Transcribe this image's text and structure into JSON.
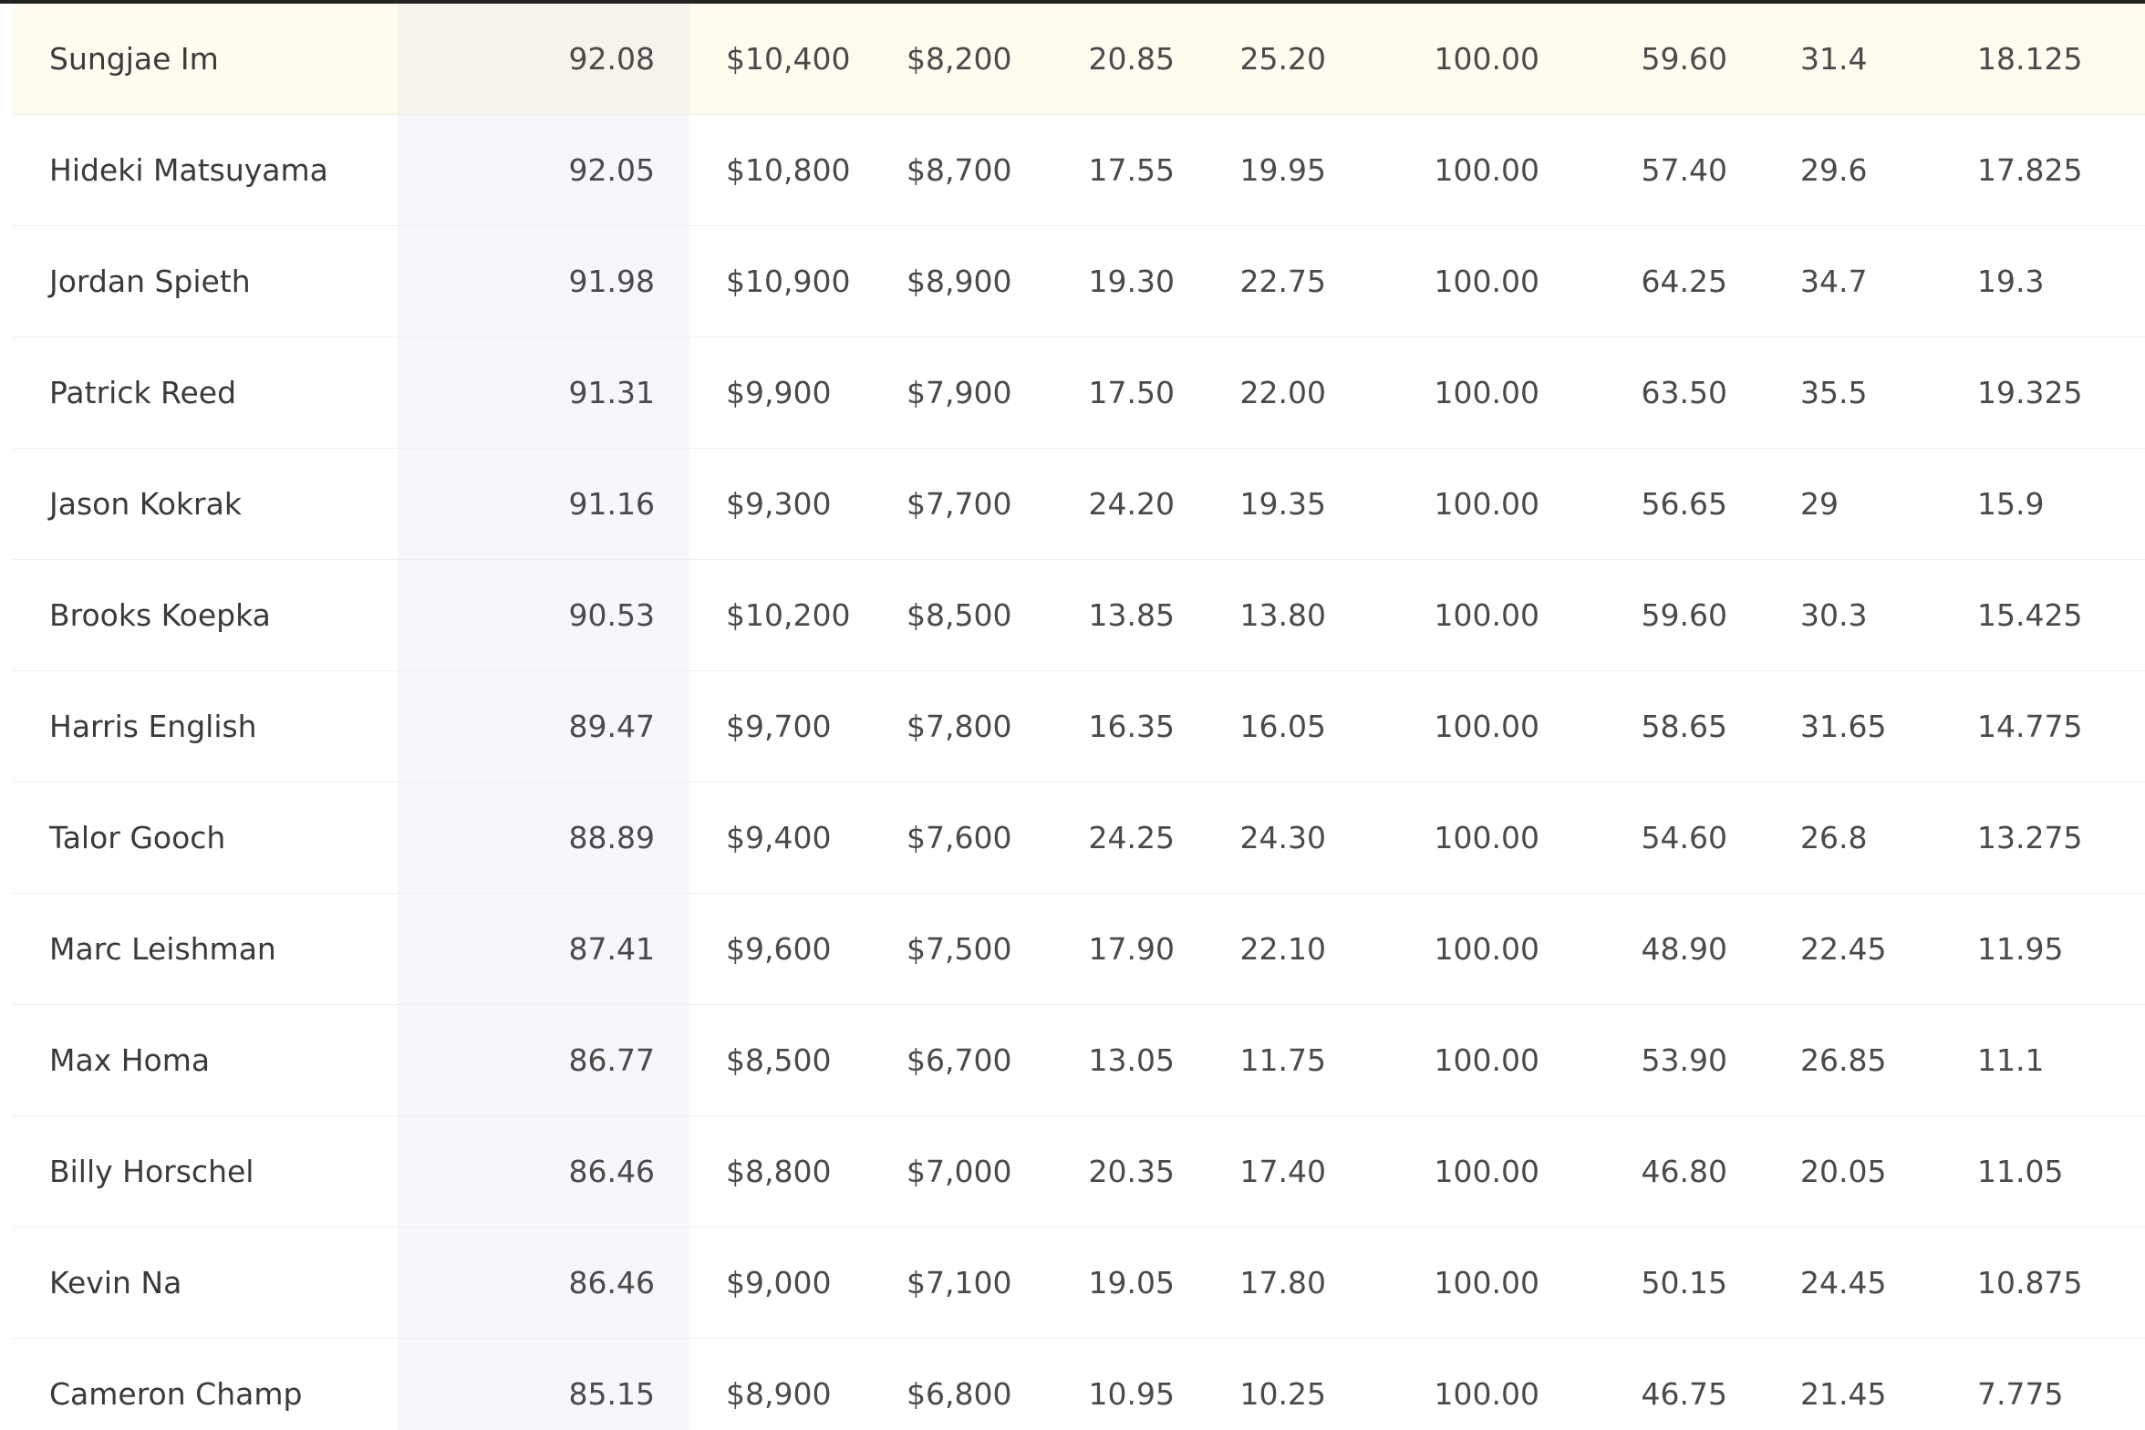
{
  "players": [
    {
      "name": "Sungjae Im",
      "proj": "92.08",
      "sal1": "$10,400",
      "sal2": "$8,200",
      "v1": "20.85",
      "v2": "25.20",
      "v3": "100.00",
      "v4": "59.60",
      "v5": "31.4",
      "v6": "18.125"
    },
    {
      "name": "Hideki Matsuyama",
      "proj": "92.05",
      "sal1": "$10,800",
      "sal2": "$8,700",
      "v1": "17.55",
      "v2": "19.95",
      "v3": "100.00",
      "v4": "57.40",
      "v5": "29.6",
      "v6": "17.825"
    },
    {
      "name": "Jordan Spieth",
      "proj": "91.98",
      "sal1": "$10,900",
      "sal2": "$8,900",
      "v1": "19.30",
      "v2": "22.75",
      "v3": "100.00",
      "v4": "64.25",
      "v5": "34.7",
      "v6": "19.3"
    },
    {
      "name": "Patrick Reed",
      "proj": "91.31",
      "sal1": "$9,900",
      "sal2": "$7,900",
      "v1": "17.50",
      "v2": "22.00",
      "v3": "100.00",
      "v4": "63.50",
      "v5": "35.5",
      "v6": "19.325"
    },
    {
      "name": "Jason Kokrak",
      "proj": "91.16",
      "sal1": "$9,300",
      "sal2": "$7,700",
      "v1": "24.20",
      "v2": "19.35",
      "v3": "100.00",
      "v4": "56.65",
      "v5": "29",
      "v6": "15.9"
    },
    {
      "name": "Brooks Koepka",
      "proj": "90.53",
      "sal1": "$10,200",
      "sal2": "$8,500",
      "v1": "13.85",
      "v2": "13.80",
      "v3": "100.00",
      "v4": "59.60",
      "v5": "30.3",
      "v6": "15.425"
    },
    {
      "name": "Harris English",
      "proj": "89.47",
      "sal1": "$9,700",
      "sal2": "$7,800",
      "v1": "16.35",
      "v2": "16.05",
      "v3": "100.00",
      "v4": "58.65",
      "v5": "31.65",
      "v6": "14.775"
    },
    {
      "name": "Talor Gooch",
      "proj": "88.89",
      "sal1": "$9,400",
      "sal2": "$7,600",
      "v1": "24.25",
      "v2": "24.30",
      "v3": "100.00",
      "v4": "54.60",
      "v5": "26.8",
      "v6": "13.275"
    },
    {
      "name": "Marc Leishman",
      "proj": "87.41",
      "sal1": "$9,600",
      "sal2": "$7,500",
      "v1": "17.90",
      "v2": "22.10",
      "v3": "100.00",
      "v4": "48.90",
      "v5": "22.45",
      "v6": "11.95"
    },
    {
      "name": "Max Homa",
      "proj": "86.77",
      "sal1": "$8,500",
      "sal2": "$6,700",
      "v1": "13.05",
      "v2": "11.75",
      "v3": "100.00",
      "v4": "53.90",
      "v5": "26.85",
      "v6": "11.1"
    },
    {
      "name": "Billy Horschel",
      "proj": "86.46",
      "sal1": "$8,800",
      "sal2": "$7,000",
      "v1": "20.35",
      "v2": "17.40",
      "v3": "100.00",
      "v4": "46.80",
      "v5": "20.05",
      "v6": "11.05"
    },
    {
      "name": "Kevin Na",
      "proj": "86.46",
      "sal1": "$9,000",
      "sal2": "$7,100",
      "v1": "19.05",
      "v2": "17.80",
      "v3": "100.00",
      "v4": "50.15",
      "v5": "24.45",
      "v6": "10.875"
    },
    {
      "name": "Cameron Champ",
      "proj": "85.15",
      "sal1": "$8,900",
      "sal2": "$6,800",
      "v1": "10.95",
      "v2": "10.25",
      "v3": "100.00",
      "v4": "46.75",
      "v5": "21.45",
      "v6": "7.775"
    }
  ]
}
